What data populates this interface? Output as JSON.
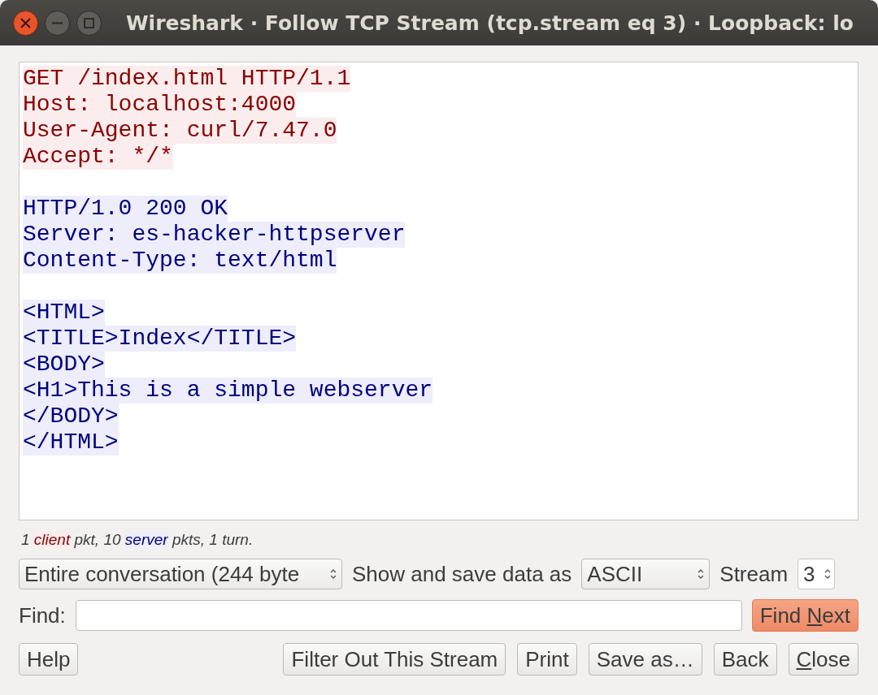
{
  "window": {
    "title": "Wireshark · Follow TCP Stream (tcp.stream eq 3) · Loopback: lo"
  },
  "stream_blocks": [
    {
      "kind": "client",
      "lines": [
        "GET /index.html HTTP/1.1",
        "Host: localhost:4000",
        "User-Agent: curl/7.47.0",
        "Accept: */*"
      ]
    },
    {
      "kind": "server",
      "lines": [
        "HTTP/1.0 200 OK",
        "Server: es-hacker-httpserver",
        "Content-Type: text/html"
      ]
    },
    {
      "kind": "server",
      "lines": [
        "<HTML>",
        "<TITLE>Index</TITLE>",
        "<BODY>",
        "<H1>This is a simple webserver",
        "</BODY>",
        "</HTML>"
      ]
    }
  ],
  "summary": [
    {
      "text": "1 "
    },
    {
      "text": "client",
      "kind": "client"
    },
    {
      "text": " pkt, 10 "
    },
    {
      "text": "server",
      "kind": "server"
    },
    {
      "text": " pkts, 1 turn."
    }
  ],
  "conversation_select": {
    "value": "Entire conversation (244 byte"
  },
  "show_as_label": "Show and save data as",
  "format_select": {
    "value": "ASCII"
  },
  "stream_label": "Stream",
  "stream_spin": {
    "value": "3"
  },
  "find_label": "Find:",
  "find_next": {
    "label": {
      "before": "Find ",
      "mnemonic": "N",
      "after": "ext"
    }
  },
  "buttons": [
    {
      "label": {
        "before": "Help"
      },
      "kind": "left"
    },
    {
      "label": {
        "before": "Filter Out This Stream"
      },
      "kind": "right"
    },
    {
      "label": {
        "before": "Print"
      },
      "kind": "right"
    },
    {
      "label": {
        "before": "Save as…"
      },
      "kind": "right"
    },
    {
      "label": {
        "before": "Back"
      },
      "kind": "right"
    },
    {
      "label": {
        "mnemonic": "C",
        "after": "lose"
      },
      "kind": "right"
    }
  ]
}
